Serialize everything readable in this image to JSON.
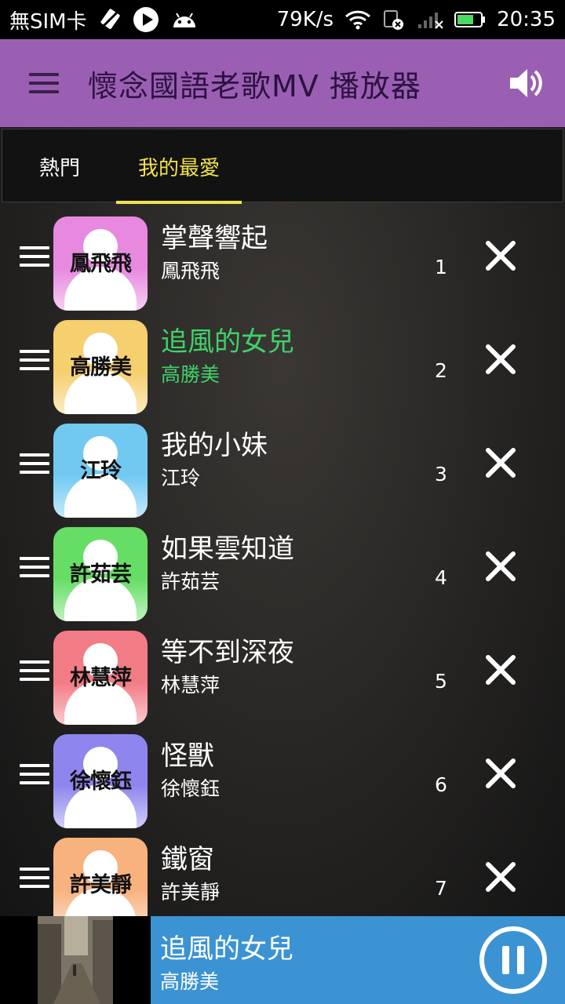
{
  "status_bar": {
    "carrier": "無SIM卡",
    "speed": "79K/s",
    "time": "20:35",
    "icons": [
      "sim-off-icon",
      "play-icon",
      "android-icon",
      "wifi-icon",
      "notify-off-icon",
      "signal-off-icon",
      "battery-icon"
    ]
  },
  "app_bar": {
    "title": "懷念國語老歌MV 播放器",
    "menu_icon": "menu-icon",
    "volume_icon": "volume-icon",
    "color": "#9a5fb3"
  },
  "tabs": [
    {
      "label": "熱門",
      "active": false
    },
    {
      "label": "我的最愛",
      "active": true
    }
  ],
  "songs": [
    {
      "title": "掌聲響起",
      "artist": "鳳飛飛",
      "avatar_label": "鳳飛飛",
      "index": "1",
      "avatar_color": "#e889e0",
      "playing": false
    },
    {
      "title": "追風的女兒",
      "artist": "高勝美",
      "avatar_label": "高勝美",
      "index": "2",
      "avatar_color": "#f6cf6e",
      "playing": true
    },
    {
      "title": "我的小妹",
      "artist": "江玲",
      "avatar_label": "江玲",
      "index": "3",
      "avatar_color": "#71c9f2",
      "playing": false
    },
    {
      "title": "如果雲知道",
      "artist": "許茹芸",
      "avatar_label": "許茹芸",
      "index": "4",
      "avatar_color": "#66de66",
      "playing": false
    },
    {
      "title": "等不到深夜",
      "artist": "林慧萍",
      "avatar_label": "林慧萍",
      "index": "5",
      "avatar_color": "#f27c86",
      "playing": false
    },
    {
      "title": "怪獸",
      "artist": "徐懷鈺",
      "avatar_label": "徐懷鈺",
      "index": "6",
      "avatar_color": "#8e86ee",
      "playing": false
    },
    {
      "title": "鐵窗",
      "artist": "許美靜",
      "avatar_label": "許美靜",
      "index": "7",
      "avatar_color": "#f7b27e",
      "playing": false
    }
  ],
  "now_playing": {
    "title": "追風的女兒",
    "artist": "高勝美",
    "state_icon": "pause-icon",
    "panel_color": "#3b93d4"
  },
  "colors": {
    "active_tab": "#f2e24a",
    "playing_text": "#3fd26a"
  }
}
